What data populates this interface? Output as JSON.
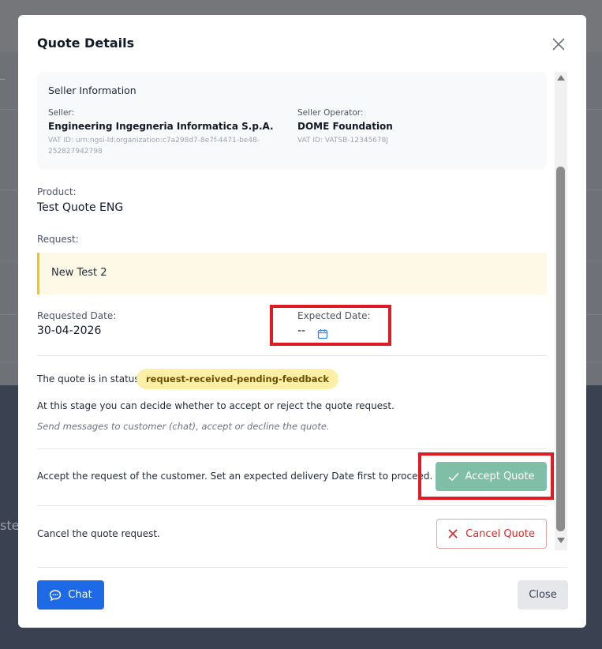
{
  "background": {
    "partial_text": "ste"
  },
  "modal": {
    "title": "Quote Details",
    "seller_info": {
      "heading": "Seller Information",
      "seller_label": "Seller:",
      "seller_name": "Engineering Ingegneria Informatica S.p.A.",
      "seller_vat_line1": "VAT ID: urn:ngsi-ld:organization:c7a298d7-8e7f-4471-be48-",
      "seller_vat_line2": "252827942798",
      "operator_label": "Seller Operator:",
      "operator_name": "DOME Foundation",
      "operator_vat": "VAT ID: VATSB-12345678J"
    },
    "product_label": "Product:",
    "product_value": "Test Quote ENG",
    "request_label": "Request:",
    "request_value": "New Test 2",
    "requested_date_label": "Requested Date:",
    "requested_date_value": "30-04-2026",
    "expected_date_label": "Expected Date:",
    "expected_date_value": "--",
    "status_prefix": "The quote is in status:",
    "status_value": "request-received-pending-feedback",
    "stage_note": "At this stage you can decide whether to accept or reject the quote request.",
    "stage_hint": "Send messages to customer (chat), accept or decline the quote.",
    "accept_text": "Accept the request of the customer. Set an expected delivery Date first to proceed.",
    "accept_button": "Accept Quote",
    "cancel_text": "Cancel the quote request.",
    "cancel_button": "Cancel Quote",
    "chat_button": "Chat",
    "close_button": "Close"
  },
  "icons": {
    "close": "close-icon",
    "calendar": "calendar-icon",
    "check": "check-icon",
    "x": "x-icon",
    "chat": "chat-bubble-icon"
  },
  "colors": {
    "primary": "#1e6ae6",
    "accept": "#7fbfa7",
    "cancel": "#dc2626",
    "status_badge_bg": "#fdf0a6",
    "highlight": "#e01b24"
  }
}
